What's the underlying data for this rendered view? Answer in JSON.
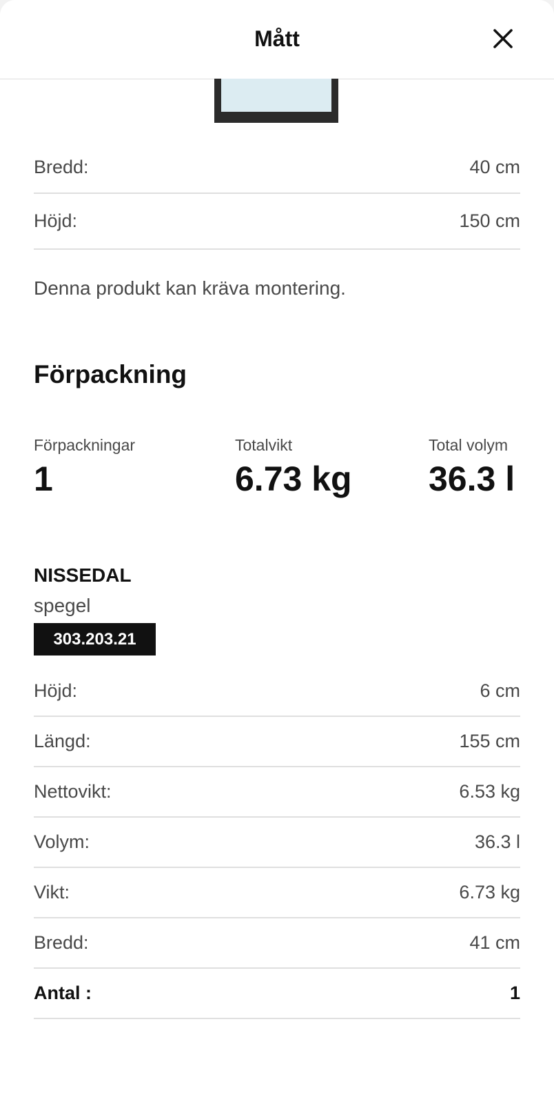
{
  "header": {
    "title": "Mått"
  },
  "dimensions": [
    {
      "label": "Bredd:",
      "value": "40 cm"
    },
    {
      "label": "Höjd:",
      "value": "150 cm"
    }
  ],
  "note": "Denna produkt kan kräva montering.",
  "packaging": {
    "title": "Förpackning",
    "stats": [
      {
        "label": "Förpackningar",
        "value": "1"
      },
      {
        "label": "Totalvikt",
        "value": "6.73 kg"
      },
      {
        "label": "Total volym",
        "value": "36.3 l"
      }
    ],
    "package": {
      "name": "NISSEDAL",
      "description": "spegel",
      "article_number": "303.203.21",
      "rows": [
        {
          "label": "Höjd:",
          "value": "6 cm"
        },
        {
          "label": "Längd:",
          "value": "155 cm"
        },
        {
          "label": "Nettovikt:",
          "value": "6.53 kg"
        },
        {
          "label": "Volym:",
          "value": "36.3 l"
        },
        {
          "label": "Vikt:",
          "value": "6.73 kg"
        },
        {
          "label": "Bredd:",
          "value": "41 cm"
        },
        {
          "label": "Antal :",
          "value": "1"
        }
      ]
    }
  },
  "icons": {
    "close": "close-icon",
    "product": "mirror-product-image"
  },
  "colors": {
    "text_primary": "#111111",
    "text_secondary": "#484848",
    "badge_bg": "#111111",
    "divider": "#dfdfdf"
  }
}
